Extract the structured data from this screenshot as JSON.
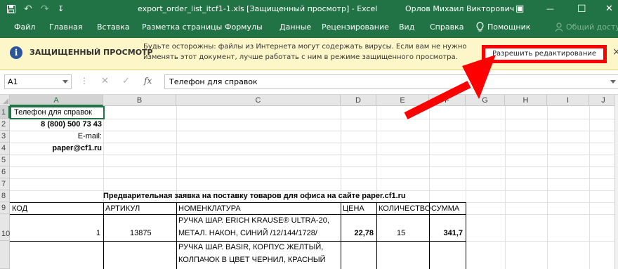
{
  "window": {
    "title": "export_order_list_itcf1-1.xls  [Защищенный просмотр]  -  Excel",
    "user": "Орлов Михаил Викторович",
    "undo_glyph": "↶",
    "redo_glyph": "↷",
    "qat_more_glyph": "↧",
    "ribbon_options_glyph": "▣",
    "minimize_glyph": "—",
    "maximize_glyph": "☐",
    "close_glyph": "✕"
  },
  "ribbon": {
    "tabs": [
      "Файл",
      "Главная",
      "Вставка",
      "Разметка страницы",
      "Формулы",
      "Данные",
      "Рецензирование",
      "Вид",
      "Справка"
    ],
    "tell_me": "Помощник",
    "share": "Общий доступ"
  },
  "protected_view": {
    "icon": "info-icon",
    "icon_glyph": "i",
    "label": "ЗАЩИЩЕННЫЙ ПРОСМОТР",
    "message_line1": "Будьте осторожны: файлы из Интернета могут содержать вирусы. Если вам не нужно",
    "message_line2": "изменять этот документ, лучше работать с ним в режиме защищенного просмотра.",
    "enable_button": "Разрешить редактирование",
    "close_glyph": "×"
  },
  "formula_bar": {
    "name_box": "A1",
    "cancel_glyph": "✕",
    "enter_glyph": "✓",
    "fx": "fx",
    "content": "Телефон для справок"
  },
  "columns": [
    "A",
    "B",
    "C",
    "D",
    "E",
    "F",
    "G",
    "H",
    "I",
    "J"
  ],
  "rows": [
    "1",
    "2",
    "3",
    "4",
    "5",
    "6",
    "7",
    "8",
    "9",
    "10",
    ""
  ],
  "cells": {
    "a1": "Телефон для справок",
    "a2": "8 (800) 500 73 43",
    "a3": "E-mail:",
    "a4": "paper@cf1.ru",
    "c7": "Предварительная заявка на поставку товаров для офиса на сайте paper.cf1.ru",
    "table_headers": [
      "КОД",
      "АРТИКУЛ",
      "НОМЕНКЛАТУРА",
      "ЦЕНА",
      "КОЛИЧЕСТВО",
      "СУММА"
    ],
    "row10": {
      "code": "1",
      "article": "13875",
      "name_line1": "РУЧКА ШАР. ERICH KRAUSE® ULTRA-20,",
      "name_line2": "МЕТАЛ. НАКОН, СИНИЙ /12/144/1728/",
      "price": "22,78",
      "qty": "15",
      "sum": "341,7"
    },
    "row11": {
      "name_line1": "РУЧКА ШАР. BASIR, КОРПУС ЖЕЛТЫЙ,",
      "name_line2": "КОЛПАЧОК В ЦВЕТ ЧЕРНИЛ, КРАСНЫЙ"
    }
  },
  "colors": {
    "excel_green": "#217346",
    "warning_bar": "#fdf6c8",
    "annotation_red": "#ff0000"
  }
}
